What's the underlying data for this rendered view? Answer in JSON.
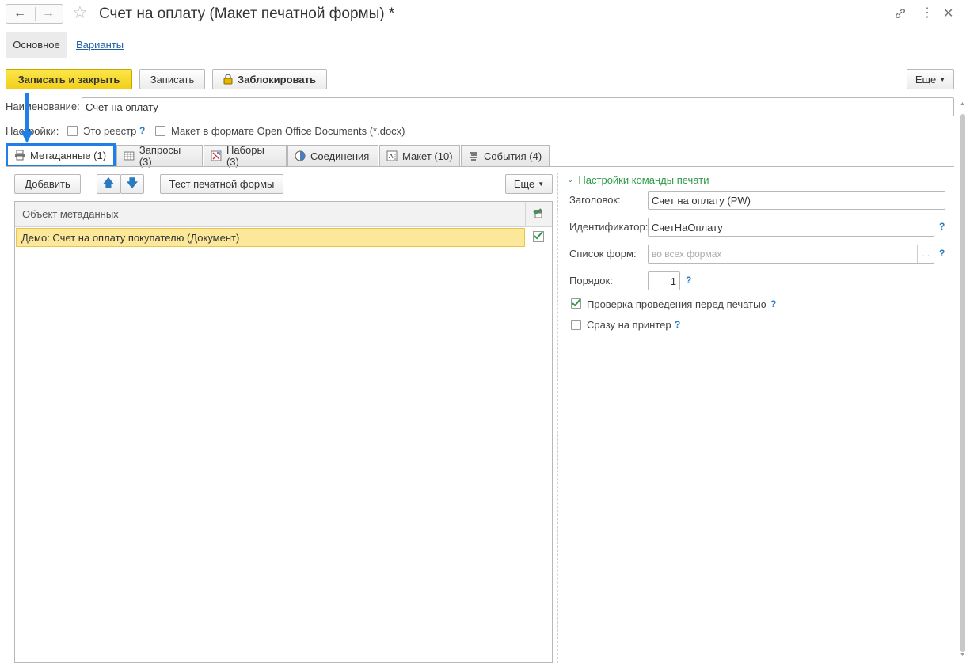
{
  "window": {
    "title": "Счет на оплату (Макет печатной формы) *"
  },
  "nav_tabs": {
    "main": "Основное",
    "variants": "Варианты"
  },
  "toolbar": {
    "save_close": "Записать и закрыть",
    "save": "Записать",
    "lock": "Заблокировать",
    "more": "Еще"
  },
  "fields": {
    "name_label": "Наименование:",
    "name_value": "Счет на оплату",
    "settings_label": "Настройки:",
    "registry_label": "Это реестр",
    "docx_label": "Макет в формате Open Office Documents (*.docx)"
  },
  "tabs": [
    {
      "label": "Метаданные (1)"
    },
    {
      "label": "Запросы (3)"
    },
    {
      "label": "Наборы (3)"
    },
    {
      "label": "Соединения"
    },
    {
      "label": "Макет (10)"
    },
    {
      "label": "События (4)"
    }
  ],
  "left_panel": {
    "add": "Добавить",
    "test_form": "Тест печатной формы",
    "more": "Еще",
    "column_header": "Объект метаданных",
    "rows": [
      {
        "name": "Демо: Счет на оплату покупателю (Документ)",
        "checked": true
      }
    ]
  },
  "print_settings": {
    "section_title": "Настройки команды печати",
    "header_label": "Заголовок:",
    "header_value": "Счет на оплату (PW)",
    "id_label": "Идентификатор:",
    "id_value": "СчетНаОплату",
    "forms_label": "Список форм:",
    "forms_placeholder": "во всех формах",
    "forms_button": "...",
    "order_label": "Порядок:",
    "order_value": "1",
    "check_posting_label": "Проверка проведения перед печатью",
    "check_posting": true,
    "direct_print_label": "Сразу на принтер",
    "direct_print": false
  },
  "help_mark": "?",
  "colors": {
    "accent": "#f3cf1a",
    "highlight_border": "#1f7fe6",
    "section_green": "#2e9a4a",
    "row_selected": "#fbe89a"
  }
}
